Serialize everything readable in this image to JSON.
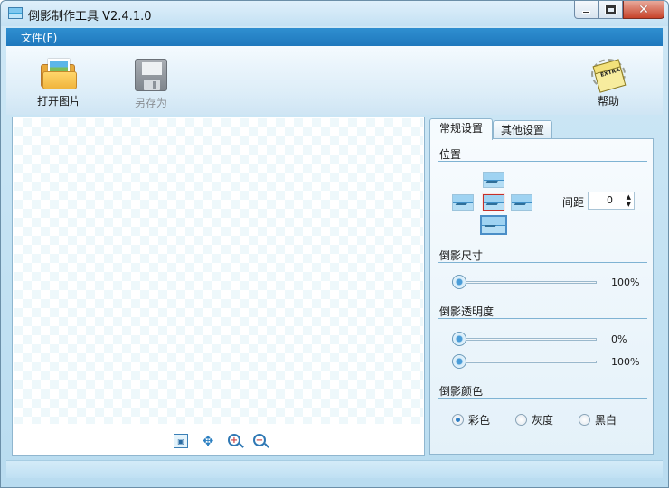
{
  "window": {
    "title": "倒影制作工具 V2.4.1.0"
  },
  "menu": {
    "file": "文件(F)"
  },
  "toolbar": {
    "open_label": "打开图片",
    "save_as_label": "另存为",
    "help_label": "帮助",
    "help_icon_text": "EXTRA"
  },
  "tabs": {
    "general": "常规设置",
    "other": "其他设置"
  },
  "settings": {
    "position_title": "位置",
    "gap_label": "间距",
    "gap_value": "0",
    "size_title": "倒影尺寸",
    "size_value": "100%",
    "opacity_title": "倒影透明度",
    "opacity_start_value": "0%",
    "opacity_end_value": "100%",
    "color_title": "倒影颜色",
    "color_options": [
      "彩色",
      "灰度",
      "黑白"
    ],
    "color_selected": "彩色"
  },
  "icons": [
    "app-icon",
    "folder-open-icon",
    "floppy-disk-icon",
    "help-icon",
    "fit-icon",
    "move-icon",
    "zoom-in-icon",
    "zoom-out-icon"
  ],
  "colors": {
    "menubar": "#1f78bd",
    "accent": "#2d7fc6",
    "selected_border": "#c4312b"
  }
}
